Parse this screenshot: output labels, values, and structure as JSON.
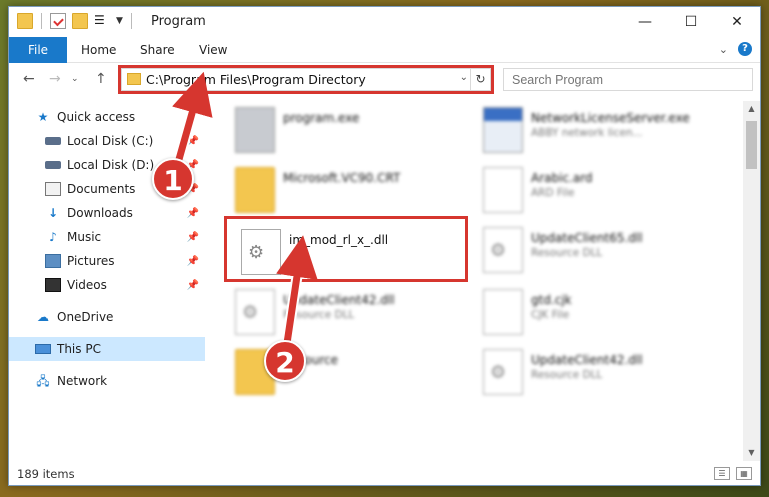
{
  "window": {
    "title": "Program"
  },
  "ribbon": {
    "tabs": [
      {
        "label": "File"
      },
      {
        "label": "Home"
      },
      {
        "label": "Share"
      },
      {
        "label": "View"
      }
    ]
  },
  "navbar": {
    "address": "C:\\Program Files\\Program Directory",
    "search_placeholder": "Search Program"
  },
  "sidebar": {
    "items": [
      {
        "label": "Quick access",
        "icon": "star-icon"
      },
      {
        "label": "Local Disk (C:)",
        "icon": "drive-icon",
        "pinned": true
      },
      {
        "label": "Local Disk (D:)",
        "icon": "drive-icon",
        "pinned": true
      },
      {
        "label": "Documents",
        "icon": "documents-icon",
        "pinned": true
      },
      {
        "label": "Downloads",
        "icon": "downloads-icon",
        "pinned": true
      },
      {
        "label": "Music",
        "icon": "music-icon",
        "pinned": true
      },
      {
        "label": "Pictures",
        "icon": "pictures-icon",
        "pinned": true
      },
      {
        "label": "Videos",
        "icon": "videos-icon",
        "pinned": true
      },
      {
        "label": "OneDrive",
        "icon": "cloud-icon"
      },
      {
        "label": "This PC",
        "icon": "computer-icon",
        "selected": true
      },
      {
        "label": "Network",
        "icon": "network-icon"
      }
    ]
  },
  "files": [
    {
      "name": "program.exe",
      "desc": "",
      "icon": "exe-icon",
      "blurred": true
    },
    {
      "name": "NetworkLicenseServer.exe",
      "desc": "ABBY network licen...",
      "icon": "exe-icon",
      "blurred": true
    },
    {
      "name": "Microsoft.VC90.CRT",
      "desc": "",
      "icon": "folder-icon",
      "blurred": true
    },
    {
      "name": "Arabic.ard",
      "desc": "ARD File",
      "icon": "file-icon",
      "blurred": true
    },
    {
      "name": "im_mod_rl_x_.dll",
      "desc": "",
      "icon": "dll-icon",
      "blurred": false
    },
    {
      "name": "UpdateClient65.dll",
      "desc": "Resource DLL",
      "icon": "dll-icon",
      "blurred": true
    },
    {
      "name": "UpdateClient42.dll",
      "desc": "Resource DLL",
      "icon": "dll-icon",
      "blurred": true
    },
    {
      "name": "gtd.cjk",
      "desc": "CJK File",
      "icon": "file-icon",
      "blurred": true
    },
    {
      "name": "Resource",
      "desc": "",
      "icon": "folder-icon",
      "blurred": true
    },
    {
      "name": "UpdateClient42.dll",
      "desc": "Resource DLL",
      "icon": "dll-icon",
      "blurred": true
    }
  ],
  "status": {
    "item_count": "189 items"
  },
  "annotations": {
    "callout1": "1",
    "callout2": "2",
    "color": "#d6362f"
  }
}
